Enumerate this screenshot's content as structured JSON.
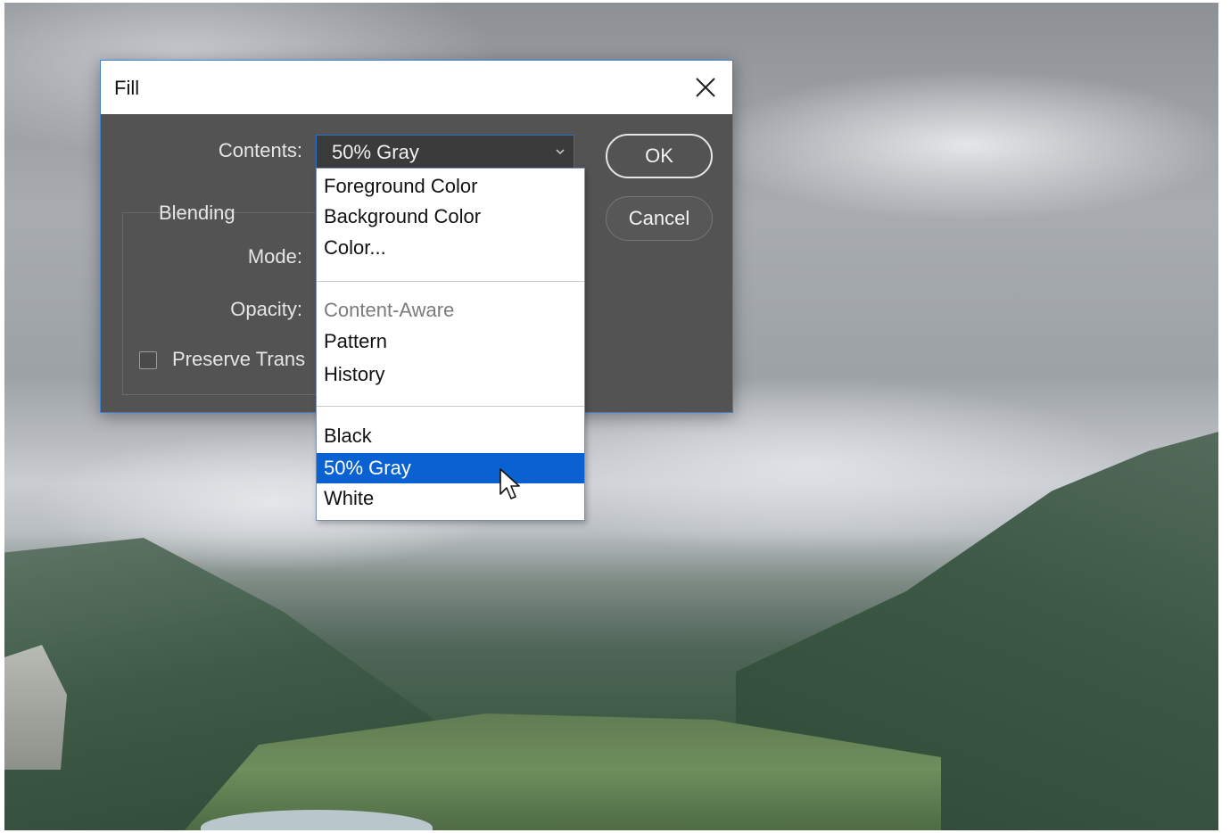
{
  "dialog": {
    "title": "Fill",
    "contents_label": "Contents:",
    "contents_value": "50% Gray",
    "blending_label": "Blending",
    "mode_label": "Mode:",
    "opacity_label": "Opacity:",
    "preserve_label": "Preserve Trans",
    "preserve_checked": false,
    "ok_label": "OK",
    "cancel_label": "Cancel"
  },
  "dropdown": {
    "options": [
      {
        "label": "Foreground Color"
      },
      {
        "label": "Background Color"
      },
      {
        "label": "Color..."
      },
      {
        "label": "Content-Aware",
        "disabled": true
      },
      {
        "label": "Pattern"
      },
      {
        "label": "History"
      },
      {
        "label": "Black"
      },
      {
        "label": "50% Gray",
        "selected": true
      },
      {
        "label": "White"
      }
    ]
  },
  "colors": {
    "dialog_bg": "#535353",
    "accent": "#0a62d2",
    "border_focus": "#3f7fd1"
  },
  "icons": [
    "close-icon",
    "chevron-down-icon",
    "mouse-pointer-icon"
  ]
}
